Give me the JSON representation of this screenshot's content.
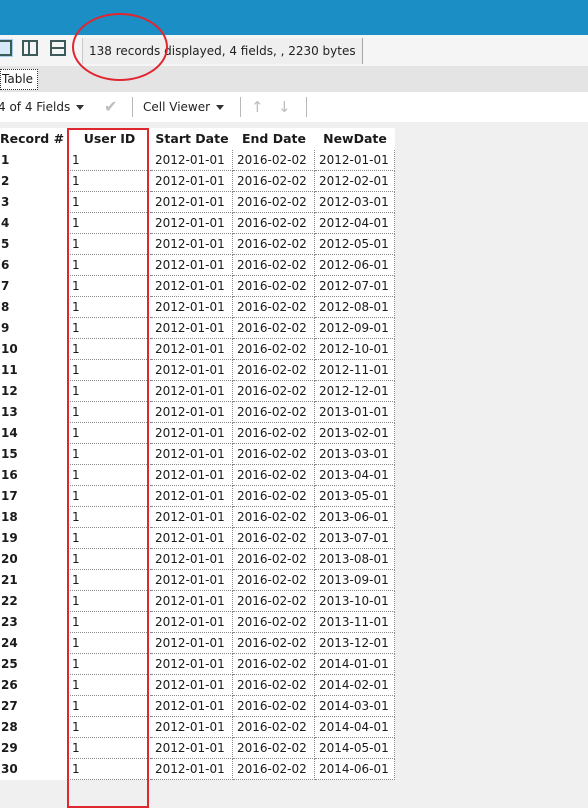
{
  "window": {
    "accent": "#1b8ec6",
    "annotation_color": "#e0262f"
  },
  "toolbar": {
    "view_buttons": [
      {
        "name": "single-view-icon",
        "selected": true
      },
      {
        "name": "split-horizontal-icon",
        "selected": false
      },
      {
        "name": "split-vertical-icon",
        "selected": false
      }
    ],
    "status": "138 records displayed, 4 fields, , 2230 bytes"
  },
  "tabs": [
    {
      "label": "Table",
      "active": true
    }
  ],
  "grid_toolbar": {
    "fields_selector": "4 of 4 Fields",
    "apply_icon": "checkmark-icon",
    "cell_viewer": "Cell Viewer",
    "move_up_icon": "arrow-up-icon",
    "move_down_icon": "arrow-down-icon"
  },
  "table": {
    "columns": [
      "Record #",
      "User ID",
      "Start Date",
      "End Date",
      "NewDate"
    ],
    "rows": [
      [
        "1",
        "1",
        "2012-01-01",
        "2016-02-02",
        "2012-01-01"
      ],
      [
        "2",
        "1",
        "2012-01-01",
        "2016-02-02",
        "2012-02-01"
      ],
      [
        "3",
        "1",
        "2012-01-01",
        "2016-02-02",
        "2012-03-01"
      ],
      [
        "4",
        "1",
        "2012-01-01",
        "2016-02-02",
        "2012-04-01"
      ],
      [
        "5",
        "1",
        "2012-01-01",
        "2016-02-02",
        "2012-05-01"
      ],
      [
        "6",
        "1",
        "2012-01-01",
        "2016-02-02",
        "2012-06-01"
      ],
      [
        "7",
        "1",
        "2012-01-01",
        "2016-02-02",
        "2012-07-01"
      ],
      [
        "8",
        "1",
        "2012-01-01",
        "2016-02-02",
        "2012-08-01"
      ],
      [
        "9",
        "1",
        "2012-01-01",
        "2016-02-02",
        "2012-09-01"
      ],
      [
        "10",
        "1",
        "2012-01-01",
        "2016-02-02",
        "2012-10-01"
      ],
      [
        "11",
        "1",
        "2012-01-01",
        "2016-02-02",
        "2012-11-01"
      ],
      [
        "12",
        "1",
        "2012-01-01",
        "2016-02-02",
        "2012-12-01"
      ],
      [
        "13",
        "1",
        "2012-01-01",
        "2016-02-02",
        "2013-01-01"
      ],
      [
        "14",
        "1",
        "2012-01-01",
        "2016-02-02",
        "2013-02-01"
      ],
      [
        "15",
        "1",
        "2012-01-01",
        "2016-02-02",
        "2013-03-01"
      ],
      [
        "16",
        "1",
        "2012-01-01",
        "2016-02-02",
        "2013-04-01"
      ],
      [
        "17",
        "1",
        "2012-01-01",
        "2016-02-02",
        "2013-05-01"
      ],
      [
        "18",
        "1",
        "2012-01-01",
        "2016-02-02",
        "2013-06-01"
      ],
      [
        "19",
        "1",
        "2012-01-01",
        "2016-02-02",
        "2013-07-01"
      ],
      [
        "20",
        "1",
        "2012-01-01",
        "2016-02-02",
        "2013-08-01"
      ],
      [
        "21",
        "1",
        "2012-01-01",
        "2016-02-02",
        "2013-09-01"
      ],
      [
        "22",
        "1",
        "2012-01-01",
        "2016-02-02",
        "2013-10-01"
      ],
      [
        "23",
        "1",
        "2012-01-01",
        "2016-02-02",
        "2013-11-01"
      ],
      [
        "24",
        "1",
        "2012-01-01",
        "2016-02-02",
        "2013-12-01"
      ],
      [
        "25",
        "1",
        "2012-01-01",
        "2016-02-02",
        "2014-01-01"
      ],
      [
        "26",
        "1",
        "2012-01-01",
        "2016-02-02",
        "2014-02-01"
      ],
      [
        "27",
        "1",
        "2012-01-01",
        "2016-02-02",
        "2014-03-01"
      ],
      [
        "28",
        "1",
        "2012-01-01",
        "2016-02-02",
        "2014-04-01"
      ],
      [
        "29",
        "1",
        "2012-01-01",
        "2016-02-02",
        "2014-05-01"
      ],
      [
        "30",
        "1",
        "2012-01-01",
        "2016-02-02",
        "2014-06-01"
      ]
    ]
  }
}
